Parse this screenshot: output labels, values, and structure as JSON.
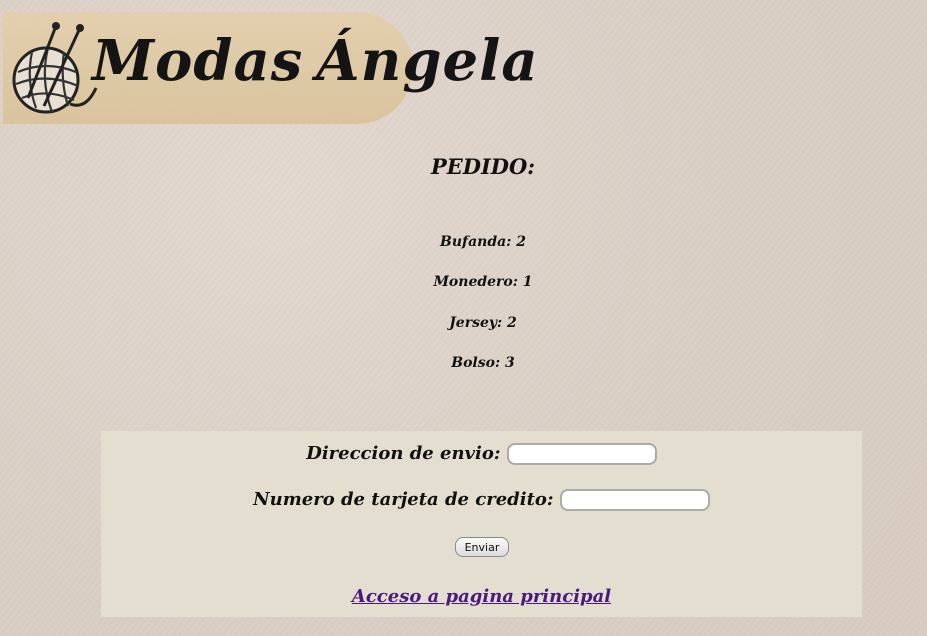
{
  "logo": {
    "text_first": "Modas",
    "text_second": "Ángela"
  },
  "title": "PEDIDO:",
  "order_items": [
    {
      "text": "Bufanda: 2"
    },
    {
      "text": "Monedero: 1"
    },
    {
      "text": "Jersey: 2"
    },
    {
      "text": "Bolso: 3"
    }
  ],
  "form": {
    "address_label": "Direccion de envio:",
    "address_value": "",
    "card_label": "Numero de tarjeta de credito:",
    "card_value": "",
    "submit_label": "Enviar",
    "home_link": "Acceso a pagina principal"
  },
  "colors": {
    "link": "#4b1a7f",
    "panel": "#e3ded0",
    "logo_bg": "#dfc9a4"
  }
}
